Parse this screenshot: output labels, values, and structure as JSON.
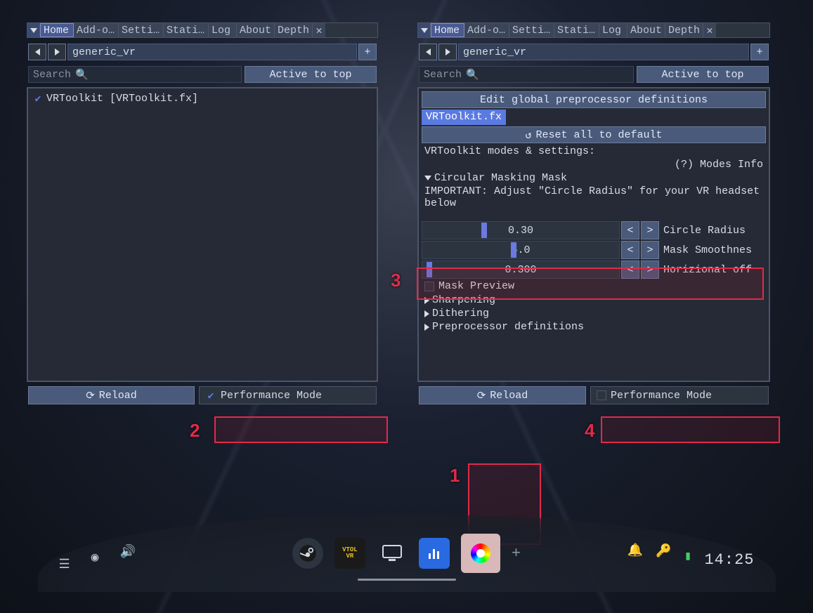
{
  "callouts": {
    "n1": "1",
    "n2": "2",
    "n3": "3",
    "n4": "4"
  },
  "left": {
    "tabs": [
      "Home",
      "Add-o…",
      "Setti…",
      "Stati…",
      "Log",
      "About",
      "Depth"
    ],
    "active_tab_index": 0,
    "profile": "generic_vr",
    "search_placeholder": "Search",
    "active_to_top": "Active to top",
    "effect": {
      "label": "VRToolkit [VRToolkit.fx]",
      "checked": true
    },
    "reload": "Reload",
    "perf": "Performance Mode",
    "perf_checked": true
  },
  "right": {
    "tabs": [
      "Home",
      "Add-o…",
      "Setti…",
      "Stati…",
      "Log",
      "About",
      "Depth"
    ],
    "active_tab_index": 0,
    "profile": "generic_vr",
    "search_placeholder": "Search",
    "active_to_top": "Active to top",
    "edit_globals": "Edit global preprocessor definitions",
    "file_tag": "VRToolkit.fx",
    "reset_all": "Reset all to default",
    "modes_header": "VRToolkit modes & settings:",
    "modes_info": "(?) Modes Info",
    "mask_section": "Circular Masking Mask",
    "important": "IMPORTANT: Adjust \"Circle Radius\" for your VR headset below",
    "sliders": [
      {
        "value": "0.30",
        "label": "Circle Radius",
        "handle_pct": 30
      },
      {
        "value": "5.0",
        "label": "Mask Smoothnes",
        "handle_pct": 45
      },
      {
        "value": "0.300",
        "label": "Horizional off",
        "handle_pct": 2
      }
    ],
    "mask_preview": "Mask Preview",
    "collapsed": [
      "Sharpening",
      "Dithering",
      "Preprocessor definitions"
    ],
    "reload": "Reload",
    "perf": "Performance Mode",
    "perf_checked": false
  },
  "dock": {
    "clock": "14:25",
    "apps": [
      "steam",
      "vtolvr",
      "desktop",
      "perf-chart",
      "reshade"
    ]
  }
}
